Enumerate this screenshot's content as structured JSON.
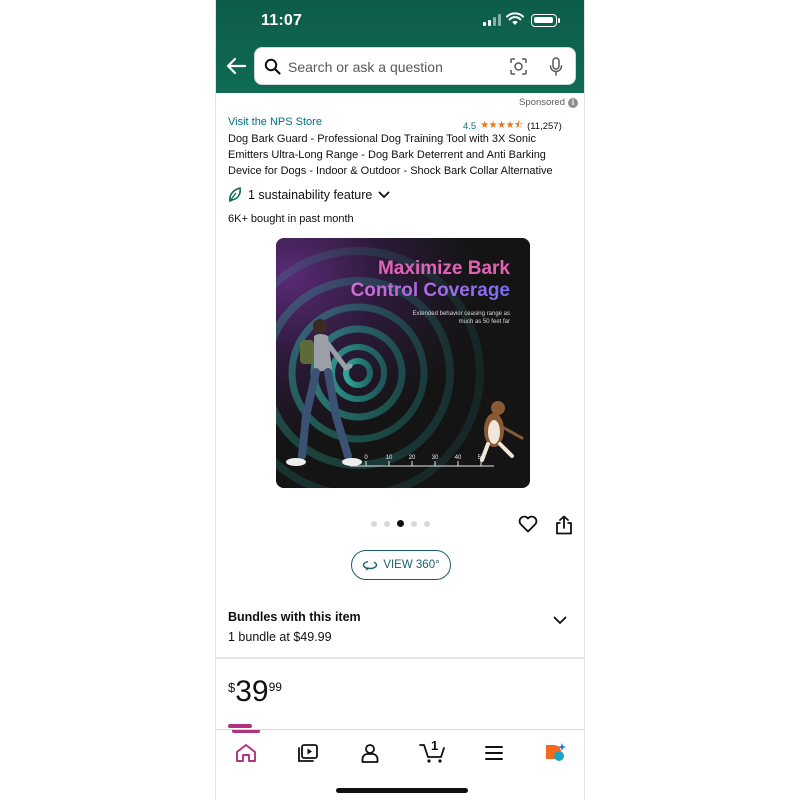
{
  "status_bar": {
    "time": "11:07"
  },
  "search": {
    "placeholder": "Search or ask a question"
  },
  "sponsored_label": "Sponsored",
  "product": {
    "store_link": "Visit the NPS Store",
    "rating": "4.5",
    "stars_glyph": "★★★★⯪",
    "review_count": "(11,257)",
    "title": "Dog Bark Guard - Professional Dog Training Tool with 3X Sonic Emitters Ultra-Long Range - Dog Bark Deterrent and Anti Barking Device for Dogs - Indoor & Outdoor - Shock Bark Collar Alternative",
    "sustainability": "1 sustainability feature",
    "bought": "6K+ bought in past month"
  },
  "image": {
    "headline_line1": "Maximize Bark",
    "headline_line2": "Control Coverage",
    "subcopy": "Extended behavior ceasing range as much as 50 feet far",
    "ruler_labels": [
      "0",
      "10",
      "20",
      "30",
      "40",
      "50"
    ],
    "carousel_count": 5,
    "carousel_active_index": 2
  },
  "view360_label": "VIEW 360°",
  "bundles": {
    "title": "Bundles with this item",
    "subtitle": "1 bundle at $49.99"
  },
  "price": {
    "currency": "$",
    "whole": "39",
    "fraction": "99"
  },
  "bottom_nav": {
    "items": [
      "home-icon",
      "video-icon",
      "account-icon",
      "cart-icon",
      "menu-icon",
      "rufus-icon"
    ],
    "cart_count": "1",
    "active_color": "#b0337f"
  },
  "colors": {
    "header": "#0f6b54",
    "link": "#007185",
    "star": "#de7921"
  }
}
